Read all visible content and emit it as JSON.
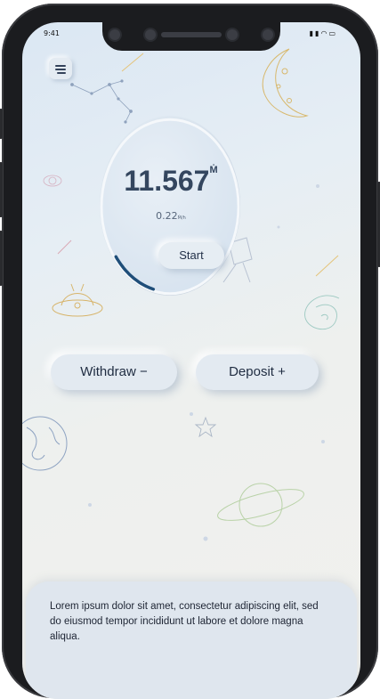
{
  "status_bar": {
    "time": "9:41",
    "indicators": "signal wifi battery"
  },
  "menu": {
    "icon": "hamburger-icon"
  },
  "balance": {
    "value": "11.567",
    "unit": "Ṁ"
  },
  "rate": {
    "value": "0.22",
    "unit": "Ṁ/h"
  },
  "progress": {
    "fraction": 0.1
  },
  "buttons": {
    "start": "Start",
    "withdraw": "Withdraw −",
    "deposit": "Deposit +"
  },
  "info": {
    "text": "Lorem ipsum dolor sit amet, consectetur adipiscing elit, sed do eiusmod tempor incididunt ut labore et dolore magna aliqua."
  },
  "colors": {
    "accent": "#1f4e79",
    "text": "#34465f",
    "background": "#e6eef4"
  }
}
